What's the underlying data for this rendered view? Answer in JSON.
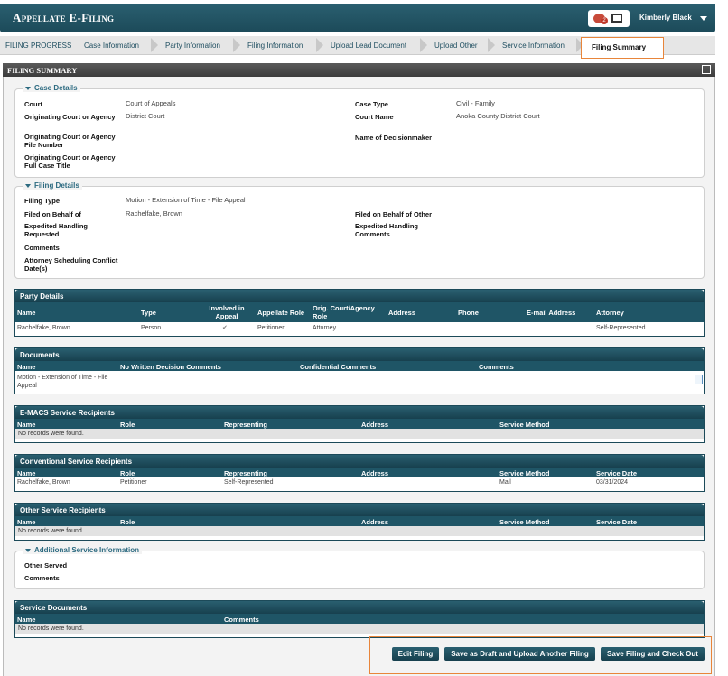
{
  "app": {
    "title": "Appellate E-Filing",
    "user": "Kimberly Black",
    "notification_count": "2"
  },
  "progress": {
    "label": "FILING PROGRESS",
    "steps": [
      {
        "label": "Case Information"
      },
      {
        "label": "Party Information"
      },
      {
        "label": "Filing Information"
      },
      {
        "label": "Upload Lead Document"
      },
      {
        "label": "Upload Other"
      },
      {
        "label": "Service Information"
      },
      {
        "label": "Filing Summary"
      }
    ]
  },
  "section_title": "FILING SUMMARY",
  "case_details": {
    "legend": "Case Details",
    "fields": [
      {
        "label": "Court",
        "value": "Court of Appeals"
      },
      {
        "label": "Originating Court or Agency",
        "value": "District Court"
      },
      {
        "label": "Originating Court or Agency File Number",
        "value": ""
      },
      {
        "label": "Originating Court or Agency Full Case Title",
        "value": ""
      },
      {
        "label": "Case Type",
        "value": "Civil - Family"
      },
      {
        "label": "Court Name",
        "value": "Anoka County District Court"
      },
      {
        "label": "Name of Decisionmaker",
        "value": ""
      }
    ]
  },
  "filing_details": {
    "legend": "Filing Details",
    "fields": [
      {
        "label": "Filing Type",
        "value": "Motion - Extension of Time - File Appeal"
      },
      {
        "label": "Filed on Behalf of",
        "value": "Rachelfake, Brown"
      },
      {
        "label": "Expedited Handling Requested",
        "value": ""
      },
      {
        "label": "Comments",
        "value": ""
      },
      {
        "label": "Attorney Scheduling Conflict Date(s)",
        "value": ""
      },
      {
        "label": "Filed on Behalf of Other",
        "value": ""
      },
      {
        "label": "Expedited Handling Comments",
        "value": ""
      }
    ]
  },
  "party_details": {
    "title": "Party Details",
    "headers": [
      "Name",
      "Type",
      "Involved in Appeal",
      "Appellate Role",
      "Orig. Court/Agency Role",
      "Address",
      "Phone",
      "E-mail Address",
      "Attorney"
    ],
    "rows": [
      {
        "name": "Rachelfake, Brown",
        "type": "Person",
        "involved": "✔",
        "appellate_role": "Petitioner",
        "orig_role": "Attorney",
        "attorney": "Self-Represented"
      }
    ]
  },
  "documents": {
    "title": "Documents",
    "headers": [
      "Name",
      "No Written Decision Comments",
      "Confidential Comments",
      "Comments"
    ],
    "rows": [
      {
        "name": "Motion - Extension of Time - File Appeal"
      }
    ]
  },
  "emacs": {
    "title": "E-MACS Service Recipients",
    "headers": [
      "Name",
      "Role",
      "Representing",
      "Address",
      "Service Method"
    ],
    "empty": "No records were found."
  },
  "conventional": {
    "title": "Conventional Service Recipients",
    "headers": [
      "Name",
      "Role",
      "Representing",
      "Address",
      "Service Method",
      "Service Date"
    ],
    "rows": [
      {
        "name": "Rachelfake, Brown",
        "role": "Petitioner",
        "representing": "Self-Represented",
        "method": "Mail",
        "date": "03/31/2024"
      }
    ]
  },
  "other_service": {
    "title": "Other Service Recipients",
    "headers": [
      "Name",
      "Role",
      "Address",
      "Service Method",
      "Service Date"
    ],
    "empty": "No records were found."
  },
  "additional": {
    "legend": "Additional Service Information",
    "fields": [
      {
        "label": "Other Served"
      },
      {
        "label": "Comments"
      }
    ]
  },
  "service_documents": {
    "title": "Service Documents",
    "headers": [
      "Name",
      "Comments"
    ],
    "empty": "No records were found."
  },
  "buttons": {
    "edit": "Edit Filing",
    "draft": "Save as Draft and Upload Another Filing",
    "checkout": "Save Filing and Check Out"
  }
}
